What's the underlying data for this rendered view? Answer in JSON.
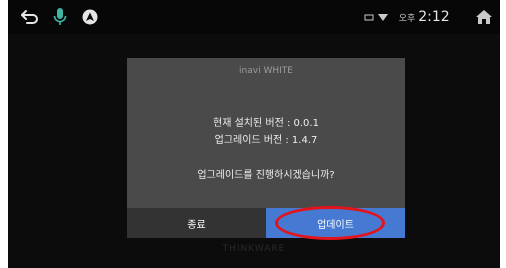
{
  "status_bar": {
    "icons": [
      "back-arrow-icon",
      "microphone-icon",
      "assistant-icon",
      "signal-wifi-icon",
      "home-icon"
    ],
    "mic_color": "#3fb6a5",
    "ampm": "오후",
    "time": "2:12"
  },
  "dialog": {
    "title": "inavi WHITE",
    "current_version": "현재 설치된 버전 : 0.0.1",
    "upgrade_version": "업그레이드 버전 : 1.4.7",
    "question": "업그레이드를 진행하시겠습니까?",
    "cancel_label": "종료",
    "update_label": "업데이트",
    "accent_color": "#4579d2",
    "highlight_color": "#e3141b"
  },
  "footer": {
    "brand": "THINKWARE"
  }
}
